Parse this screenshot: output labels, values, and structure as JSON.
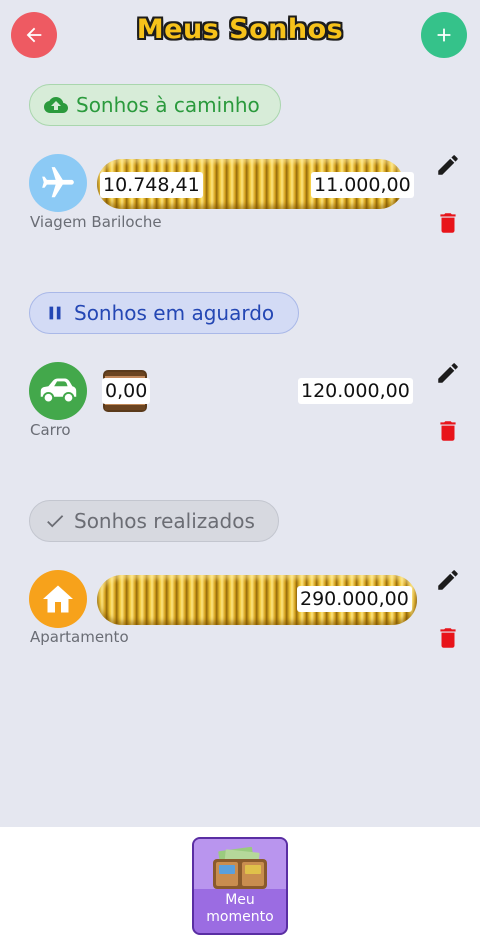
{
  "header": {
    "title": "Meus Sonhos",
    "back_icon": "arrow-left-icon",
    "add_icon": "plus-icon",
    "back_color": "#ee5a62",
    "add_color": "#35c28a"
  },
  "sections": {
    "in_progress": {
      "label": "Sonhos à caminho",
      "icon": "cloud-upload-icon",
      "dream": {
        "name": "Viagem Bariloche",
        "icon": "airplane-icon",
        "current": "10.748,41",
        "goal": "11.000,00",
        "progress": 0.977
      }
    },
    "waiting": {
      "label": "Sonhos em aguardo",
      "icon": "pause-icon",
      "dream": {
        "name": "Carro",
        "icon": "car-icon",
        "current": "0,00",
        "goal": "120.000,00",
        "progress": 0.0
      }
    },
    "achieved": {
      "label": "Sonhos realizados",
      "icon": "check-icon",
      "dream": {
        "name": "Apartamento",
        "icon": "home-icon",
        "current": "290.000,00",
        "progress": 1.0
      }
    }
  },
  "actions": {
    "edit_icon": "pencil-icon",
    "delete_icon": "trash-icon",
    "delete_color": "#e8141a"
  },
  "bottom": {
    "button_label_line1": "Meu",
    "button_label_line2": "momento",
    "button_icon": "wallet-icon"
  }
}
